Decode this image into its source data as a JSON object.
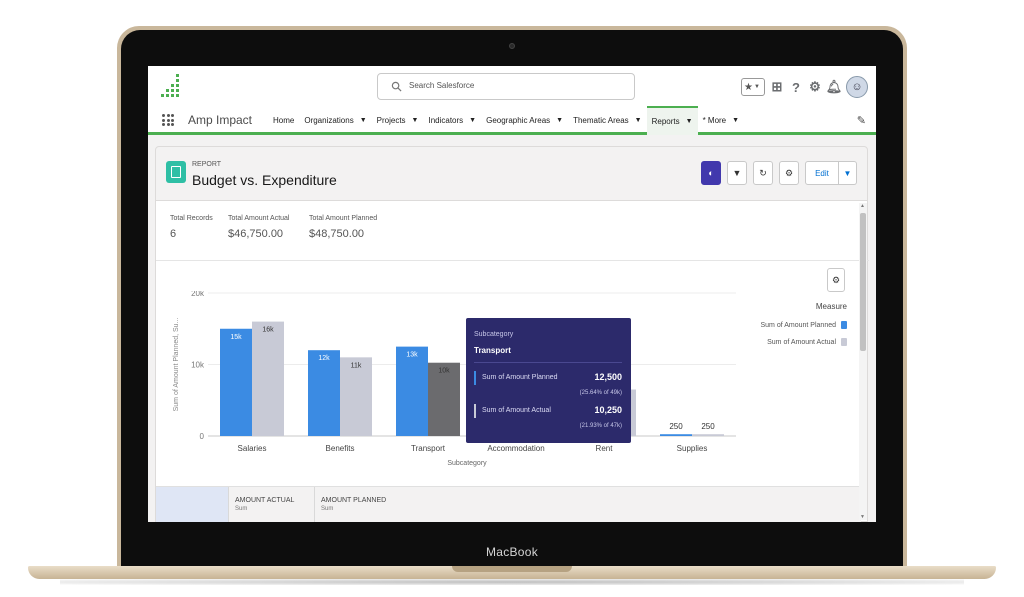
{
  "device": {
    "label": "MacBook"
  },
  "global_header": {
    "search_placeholder": "Search Salesforce",
    "icons": [
      "logo-icon",
      "search-icon",
      "favorites-star-icon",
      "add-icon",
      "help-icon",
      "setup-gear-icon",
      "notifications-bell-icon",
      "avatar"
    ]
  },
  "nav": {
    "app_name": "Amp Impact",
    "items": [
      {
        "label": "Home",
        "dropdown": false
      },
      {
        "label": "Organizations",
        "dropdown": true
      },
      {
        "label": "Projects",
        "dropdown": true
      },
      {
        "label": "Indicators",
        "dropdown": true
      },
      {
        "label": "Geographic Areas",
        "dropdown": true
      },
      {
        "label": "Thematic Areas",
        "dropdown": true
      },
      {
        "label": "Reports",
        "dropdown": true,
        "active": true
      },
      {
        "label": "* More",
        "dropdown": true
      }
    ],
    "accent_color": "#4caf50"
  },
  "report": {
    "type_label": "REPORT",
    "title": "Budget vs. Expenditure",
    "actions": {
      "edit_label": "Edit"
    },
    "summary": {
      "total_records_label": "Total Records",
      "total_records_value": "6",
      "total_actual_label": "Total Amount Actual",
      "total_actual_value": "$46,750.00",
      "total_planned_label": "Total Amount Planned",
      "total_planned_value": "$48,750.00"
    },
    "legend": {
      "title": "Measure",
      "items": [
        {
          "label": "Sum of Amount Planned",
          "color": "#3b8be3"
        },
        {
          "label": "Sum of Amount Actual",
          "color": "#c8cad6"
        }
      ]
    },
    "tooltip": {
      "category_label": "Subcategory",
      "category_value": "Transport",
      "rows": [
        {
          "name": "Sum of Amount Planned",
          "value": "12,500",
          "pct": "(25.64% of 49k)",
          "color": "#3b8be3"
        },
        {
          "name": "Sum of Amount Actual",
          "value": "10,250",
          "pct": "(21.93% of 47k)",
          "color": "#c8cad6"
        }
      ]
    },
    "table": {
      "columns": [
        {
          "label": "AMOUNT ACTUAL",
          "sub": "Sum"
        },
        {
          "label": "AMOUNT PLANNED",
          "sub": "Sum"
        }
      ]
    }
  },
  "chart_data": {
    "type": "bar",
    "xlabel": "Subcategory",
    "ylabel": "Sum of Amount Planned, Su...",
    "ylim": [
      0,
      20000
    ],
    "yticks": [
      0,
      10000,
      20000
    ],
    "ytick_labels": [
      "0",
      "10k",
      "20k"
    ],
    "categories": [
      "Salaries",
      "Benefits",
      "Transport",
      "Accommodation",
      "Rent",
      "Supplies"
    ],
    "series": [
      {
        "name": "Sum of Amount Planned",
        "color": "#3b8be3",
        "values": [
          15000,
          12000,
          12500,
          null,
          null,
          250
        ],
        "labels": [
          "15k",
          "12k",
          "13k",
          "",
          "",
          "250"
        ]
      },
      {
        "name": "Sum of Amount Actual",
        "color": "#c8cad6",
        "values": [
          16000,
          11000,
          10250,
          null,
          6500,
          250
        ],
        "labels": [
          "16k",
          "11k",
          "10k",
          "",
          "",
          "250"
        ]
      }
    ],
    "highlighted": {
      "category": "Transport",
      "series": "Sum of Amount Actual",
      "color": "#6b6b6e"
    },
    "grid": true,
    "legend_position": "right"
  }
}
